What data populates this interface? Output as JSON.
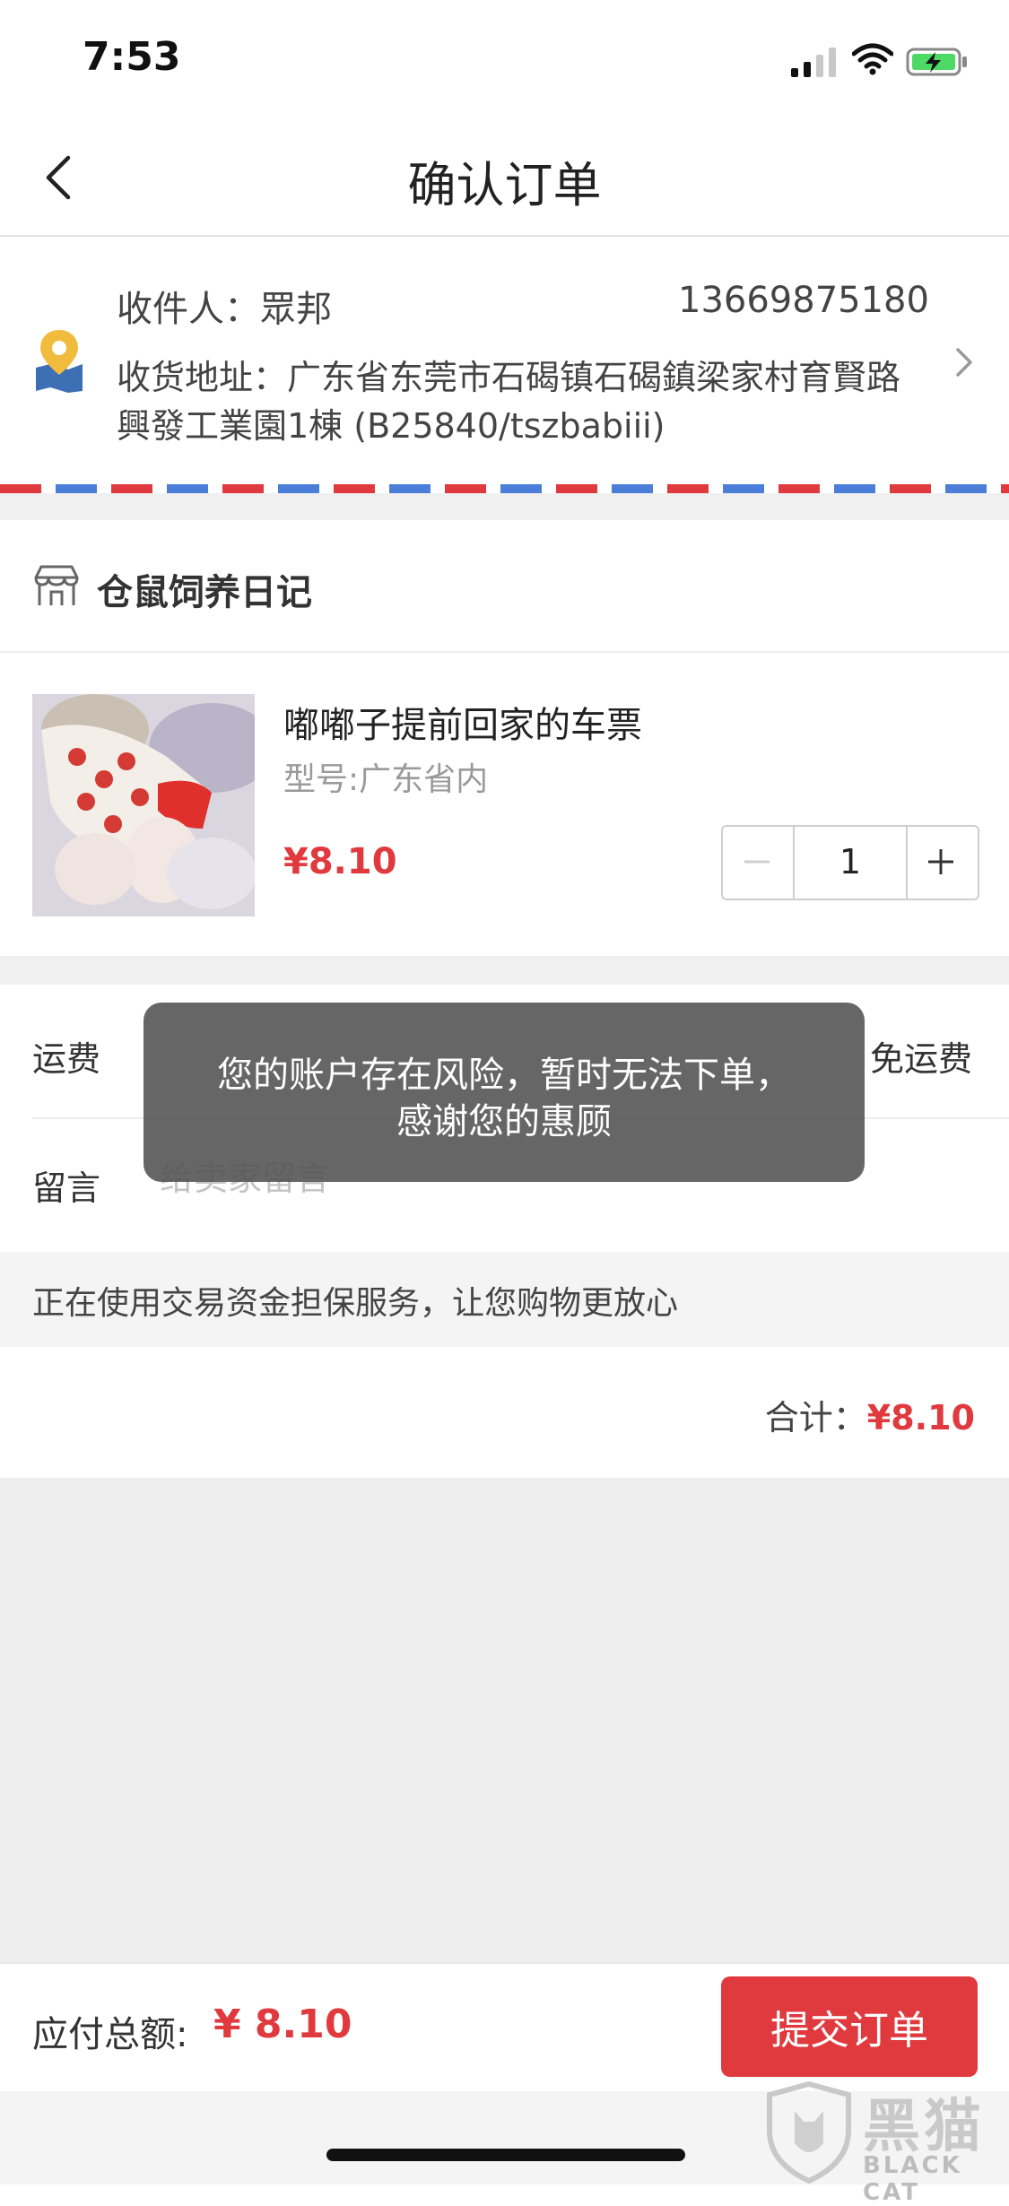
{
  "status_bar": {
    "time": "7:53"
  },
  "nav": {
    "title": "确认订单"
  },
  "address": {
    "recipient": "收件人：眾邦",
    "phone": "13669875180",
    "address": "收货地址：广东省东莞市石碣镇石碣鎮梁家村育賢路興發工業園1棟 (B25840/tszbabiii)"
  },
  "shop": {
    "name": "仓鼠饲养日记"
  },
  "product": {
    "title": "嘟嘟子提前回家的车票",
    "spec": "型号:广东省内",
    "price": "¥8.10",
    "quantity": "1",
    "minus": "−",
    "plus": "+"
  },
  "shipping": {
    "label": "运费",
    "value": "免运费"
  },
  "message": {
    "label": "留言",
    "placeholder": "给卖家留言"
  },
  "guarantee": {
    "text": "正在使用交易资金担保服务，让您购物更放心"
  },
  "total": {
    "label": "合计：",
    "amount": "¥8.10"
  },
  "footer": {
    "pay_label": "应付总额:",
    "pay_amount": "¥ 8.10",
    "submit_label": "提交订单"
  },
  "toast": {
    "line1": "您的账户存在风险，暂时无法下单，",
    "line2": "感谢您的惠顾"
  },
  "watermark": {
    "title": "黑猫",
    "subtitle": "BLACK CAT"
  },
  "colors": {
    "accent": "#e0393e",
    "toast_bg": "#555555",
    "page_bg": "#eeeeee"
  },
  "icons": [
    "back-arrow-icon",
    "location-pin-icon",
    "chevron-right-icon",
    "shop-icon",
    "signal-icon",
    "wifi-icon",
    "battery-charging-icon"
  ]
}
